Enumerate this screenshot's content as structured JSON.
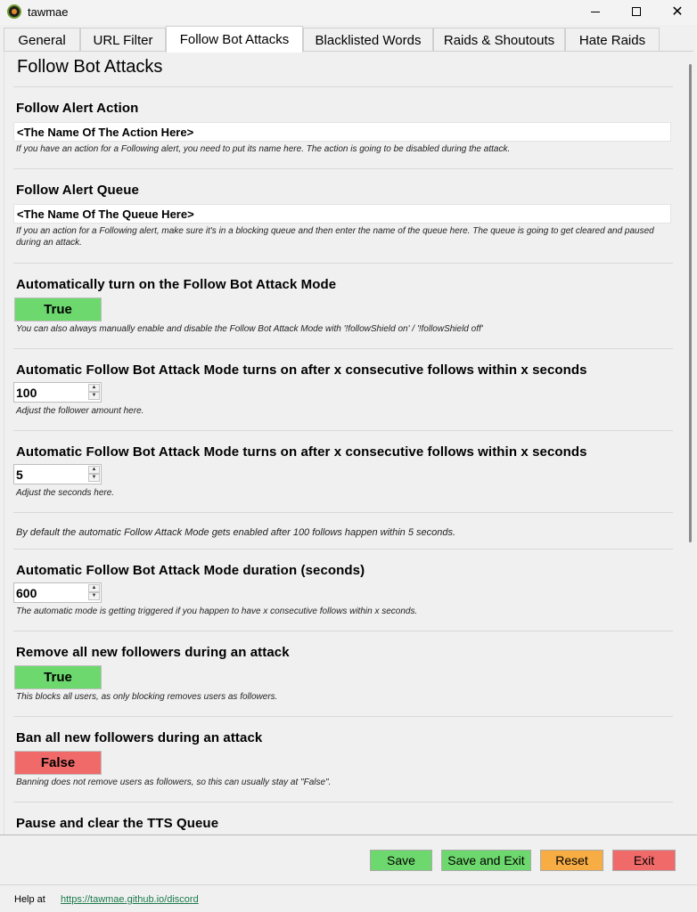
{
  "window": {
    "title": "tawmae"
  },
  "tabs": [
    {
      "label": "General"
    },
    {
      "label": "URL Filter"
    },
    {
      "label": "Follow Bot Attacks"
    },
    {
      "label": "Blacklisted Words"
    },
    {
      "label": "Raids & Shoutouts"
    },
    {
      "label": "Hate Raids"
    }
  ],
  "page": {
    "title": "Follow Bot Attacks",
    "sections": {
      "alert_action": {
        "title": "Follow Alert Action",
        "value": "<The Name Of The Action Here>",
        "hint": "If you have an action for a Following alert, you need to put its name here. The action is going to be disabled during the attack."
      },
      "alert_queue": {
        "title": "Follow Alert Queue",
        "value": "<The Name Of The Queue Here>",
        "hint": "If you an action for a Following alert, make sure it's in a blocking queue and then enter the name of the queue here. The queue is going to get cleared and paused during an attack."
      },
      "auto_mode": {
        "title": "Automatically turn on the Follow Bot Attack Mode",
        "value": "True",
        "hint": "You can also always manually enable and disable the Follow Bot Attack Mode with '!followShield on' / '!followShield off'"
      },
      "follow_count": {
        "title": "Automatic Follow Bot Attack Mode turns on after x consecutive follows within x seconds",
        "value": "100",
        "hint": "Adjust the follower amount here."
      },
      "follow_seconds": {
        "title": "Automatic Follow Bot Attack Mode turns on after x consecutive follows within x seconds",
        "value": "5",
        "hint": "Adjust the seconds here."
      },
      "default_note": "By default the automatic Follow Attack Mode gets enabled after 100 follows happen within 5 seconds.",
      "duration": {
        "title": "Automatic Follow Bot Attack Mode duration (seconds)",
        "value": "600",
        "hint": "The automatic mode is getting triggered if you happen to have x consecutive follows within x seconds."
      },
      "remove_followers": {
        "title": "Remove all new followers during an attack",
        "value": "True",
        "hint": "This blocks all users, as only blocking removes users as followers."
      },
      "ban_followers": {
        "title": "Ban all new followers during an attack",
        "value": "False",
        "hint": "Banning does not remove users as followers, so this can usually stay at \"False\"."
      },
      "tts_queue": {
        "title": "Pause and clear the TTS Queue"
      }
    }
  },
  "footer": {
    "save": "Save",
    "save_exit": "Save and Exit",
    "reset": "Reset",
    "exit": "Exit",
    "help_label": "Help at",
    "help_link": "https://tawmae.github.io/discord"
  },
  "colors": {
    "true_green": "#6dd86d",
    "false_red": "#f16a6a",
    "reset_orange": "#f7ad44",
    "link": "#1a7a4c"
  }
}
